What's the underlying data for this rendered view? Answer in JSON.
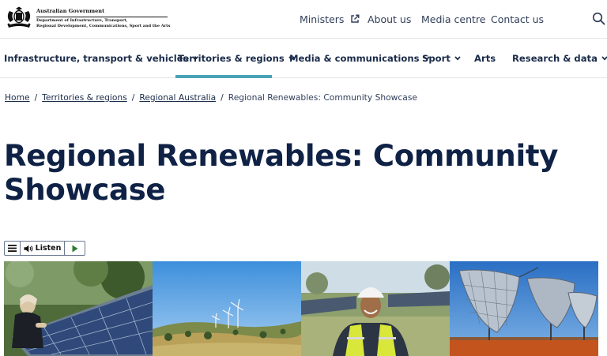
{
  "header": {
    "gov_name": "Australian Government",
    "dept_lines": [
      "Department of Infrastructure, Transport,",
      "Regional Development, Communications, Sport and the Arts"
    ],
    "utility_links": [
      "Ministers",
      "About us",
      "Media centre",
      "Contact us"
    ]
  },
  "nav": {
    "items": [
      {
        "label": "Infrastructure, transport & vehicles",
        "has_menu": true
      },
      {
        "label": "Territories & regions",
        "has_menu": true,
        "active": true
      },
      {
        "label": "Media & communications",
        "has_menu": true
      },
      {
        "label": "Sport",
        "has_menu": true
      },
      {
        "label": "Arts",
        "has_menu": false
      },
      {
        "label": "Research & data",
        "has_menu": true
      }
    ]
  },
  "breadcrumb": {
    "items": [
      "Home",
      "Territories & regions",
      "Regional Australia"
    ],
    "current": "Regional Renewables: Community Showcase",
    "separator": "/"
  },
  "page": {
    "title": "Regional Renewables: Community Showcase"
  },
  "listen": {
    "label": "Listen",
    "icons": [
      "menu-icon",
      "speaker-icon",
      "play-icon"
    ]
  },
  "images": [
    {
      "subject": "person-installing-solar-panel"
    },
    {
      "subject": "wind-turbines-on-hills"
    },
    {
      "subject": "worker-in-hard-hat-at-solar-farm"
    },
    {
      "subject": "solar-dish-concentrators"
    }
  ],
  "colors": {
    "brand_navy": "#0f2246",
    "active_underline": "#4aa3b5",
    "play_green": "#2e7d32"
  }
}
